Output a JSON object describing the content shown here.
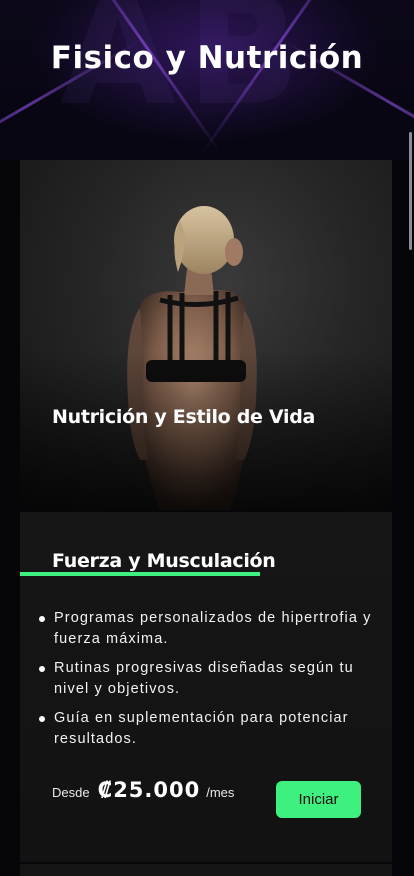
{
  "header": {
    "title": "Fisico y Nutrición"
  },
  "cards": [
    {
      "title": "Nutrición y Estilo de Vida"
    }
  ],
  "plan": {
    "title": "Fuerza y Musculación",
    "features": [
      "Programas personalizados de hipertrofia y fuerza máxima.",
      "Rutinas progresivas diseñadas según tu nivel y objetivos.",
      "Guía en suplementación para potenciar resultados."
    ],
    "price_prefix": "Desde",
    "price": "₡25.000",
    "price_suffix": "/mes",
    "cta_label": "Iniciar"
  },
  "colors": {
    "accent": "#3ef07f",
    "background": "#05050a",
    "hero_glow": "#5a28aa"
  }
}
